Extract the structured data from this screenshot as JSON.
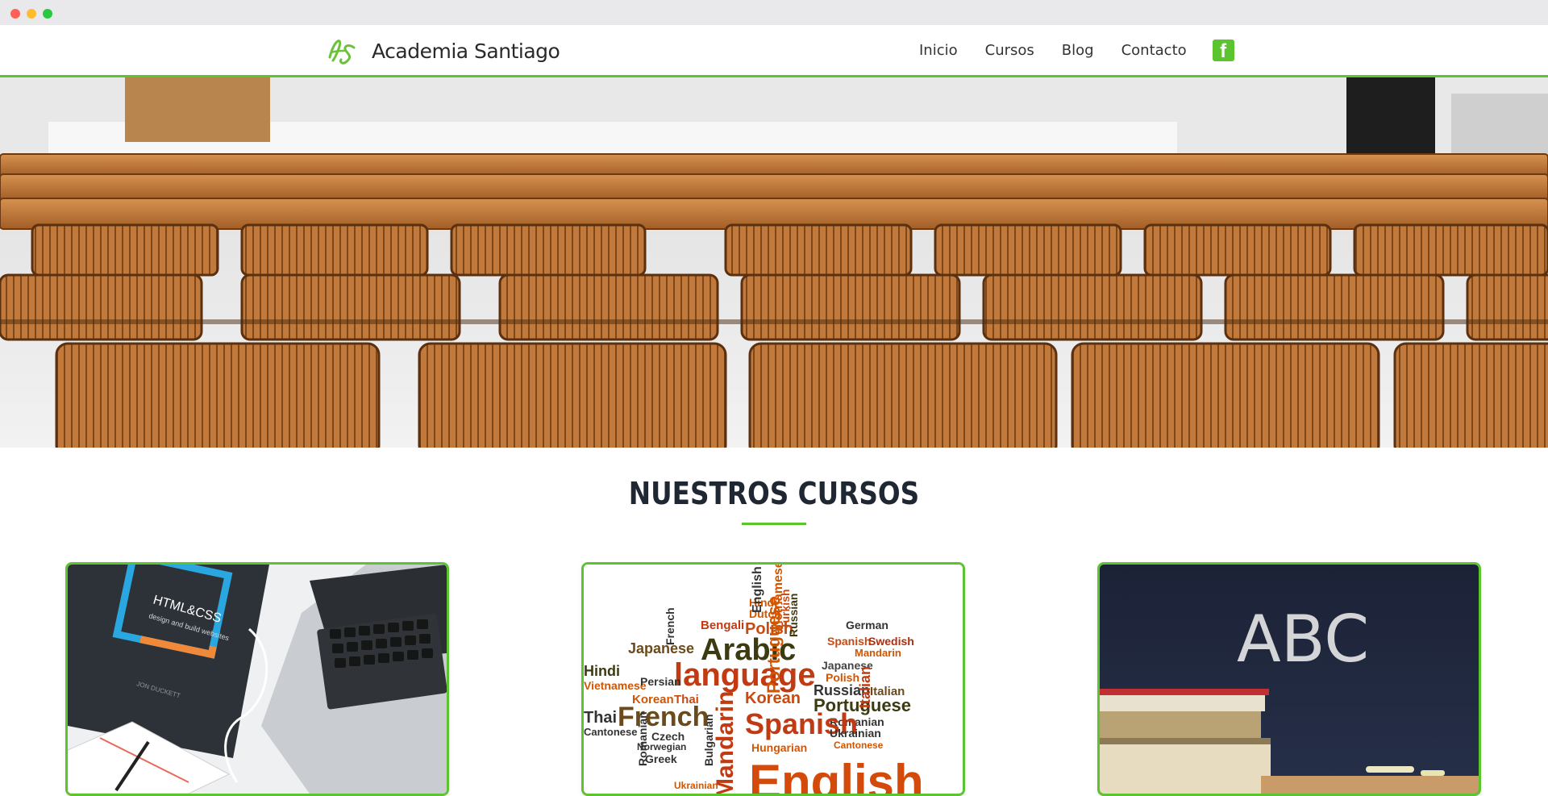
{
  "brand": {
    "name": "Academia Santiago",
    "logo_mark": "AS",
    "accent_color": "#5cc42e"
  },
  "nav": {
    "items": [
      {
        "label": "Inicio"
      },
      {
        "label": "Cursos"
      },
      {
        "label": "Blog"
      },
      {
        "label": "Contacto"
      }
    ],
    "social_icon": "facebook-icon"
  },
  "hero": {
    "image": "lecture-hall-wooden-seats"
  },
  "courses_section": {
    "title": "NUESTROS CURSOS"
  },
  "courses": [
    {
      "image": "html-css-book-laptop",
      "book_title": "HTML&CSS",
      "book_subtitle": "design and build websites",
      "book_author": "JON DUCKETT"
    },
    {
      "image": "languages-word-cloud",
      "words": [
        "Hindi",
        "English",
        "Dutch",
        "Bengali",
        "Polish",
        "German",
        "Japanese",
        "Arabic",
        "Russian",
        "Spanish",
        "Swedish",
        "Mandarin",
        "language",
        "Vietnamese",
        "Portuguese",
        "Persian",
        "Italian",
        "French",
        "Korean",
        "Thai",
        "Czech",
        "Cantonese",
        "Romanian",
        "Ukrainian",
        "Bulgarian",
        "Greek",
        "Norwegian",
        "Hungarian",
        "Turkish"
      ]
    },
    {
      "image": "chalkboard-abc-books",
      "board_text": "ABC"
    }
  ]
}
